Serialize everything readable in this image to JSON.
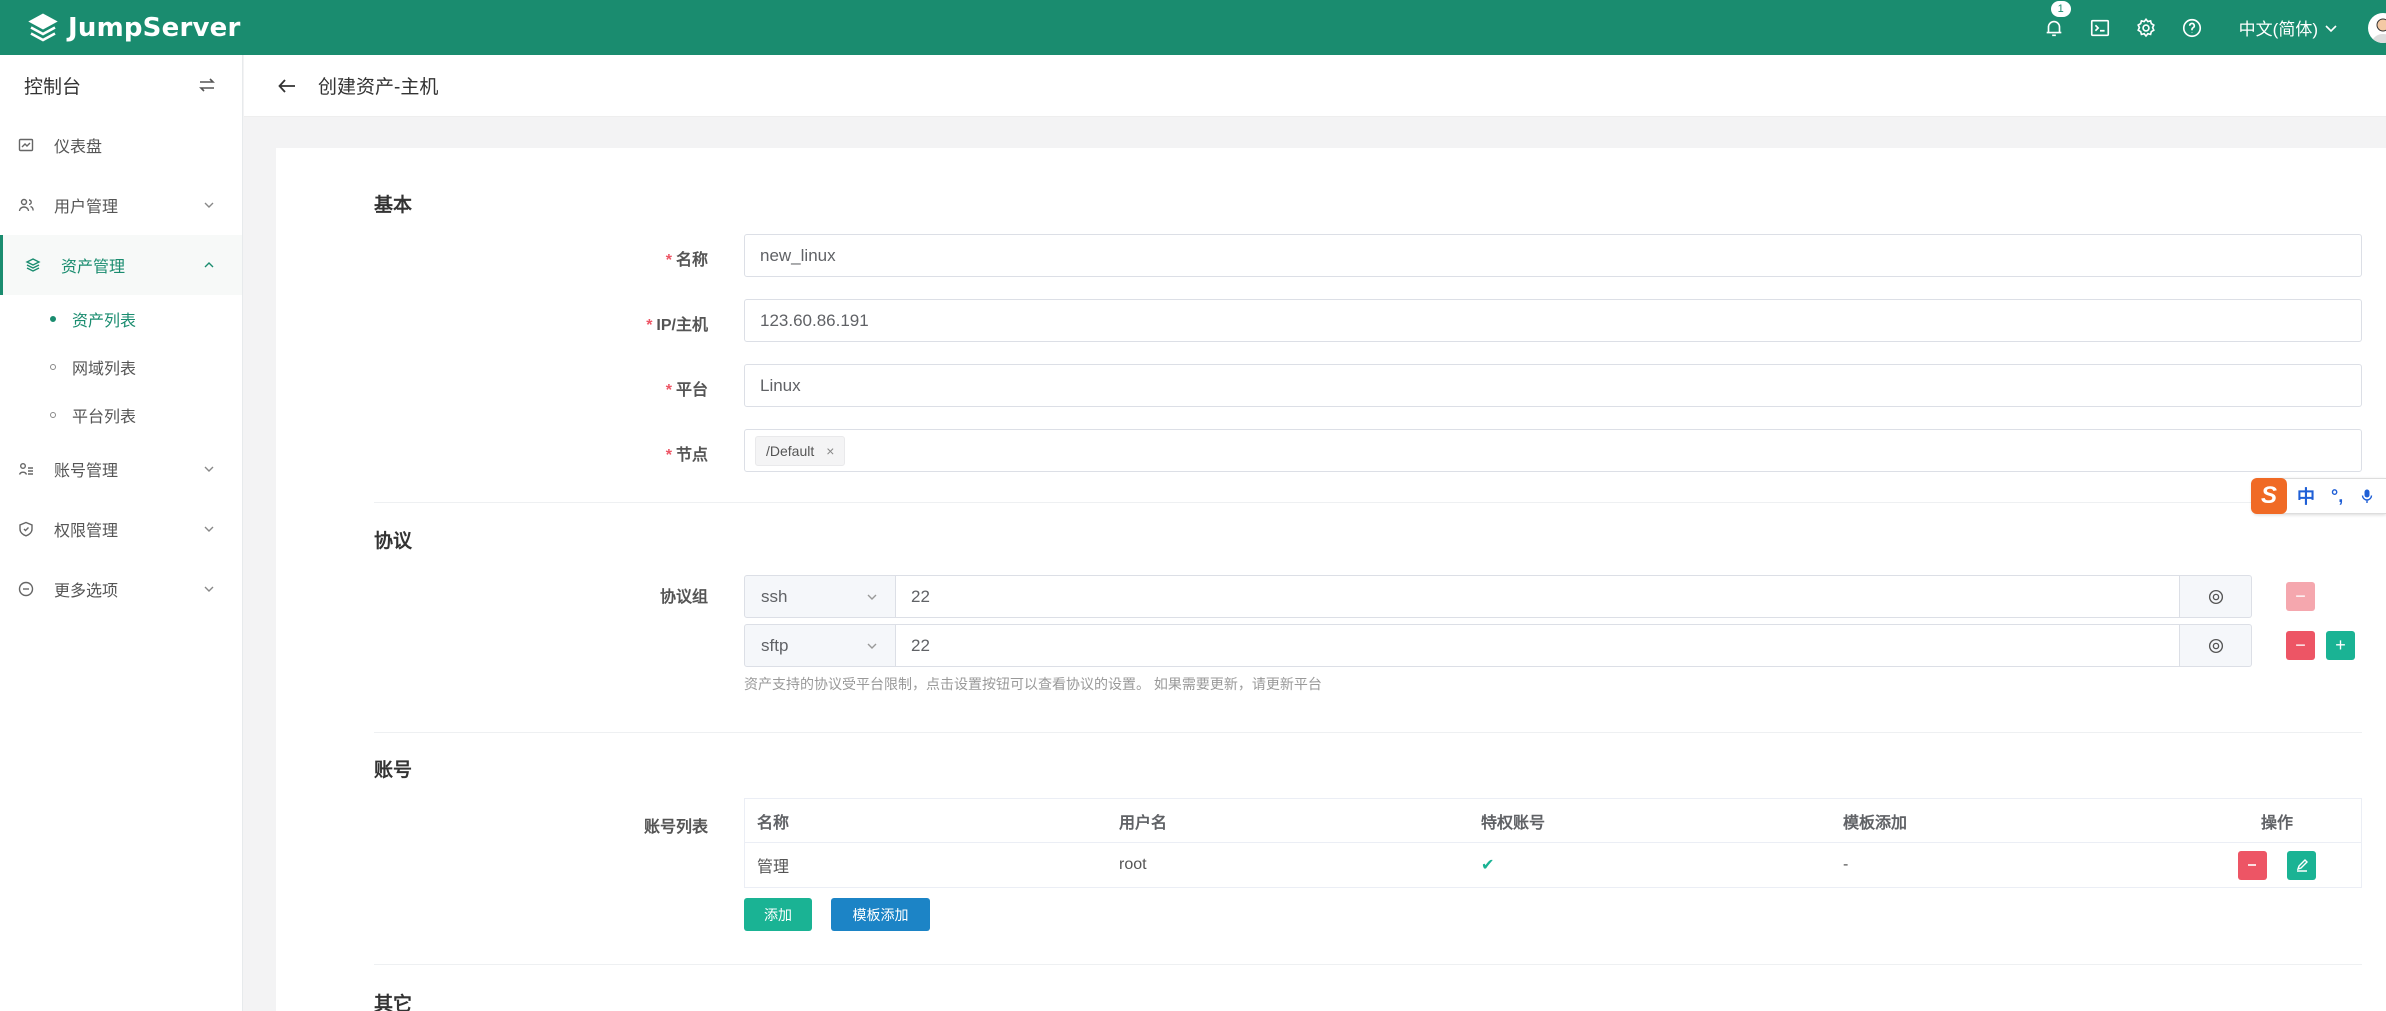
{
  "app": {
    "logo_text": "JumpServer",
    "notification_count": "1",
    "language": "中文(简体)"
  },
  "sidebar": {
    "title": "控制台",
    "items": [
      {
        "label": "仪表盘"
      },
      {
        "label": "用户管理"
      },
      {
        "label": "资产管理"
      },
      {
        "label": "账号管理"
      },
      {
        "label": "权限管理"
      },
      {
        "label": "更多选项"
      }
    ],
    "asset_sub": [
      {
        "label": "资产列表"
      },
      {
        "label": "网域列表"
      },
      {
        "label": "平台列表"
      }
    ]
  },
  "page": {
    "title": "创建资产-主机"
  },
  "basic": {
    "title": "基本",
    "name_label": "名称",
    "name_value": "new_linux",
    "ip_label": "IP/主机",
    "ip_value": "123.60.86.191",
    "platform_label": "平台",
    "platform_value": "Linux",
    "node_label": "节点",
    "node_tag": "/Default"
  },
  "protocols": {
    "title": "协议",
    "group_label": "协议组",
    "rows": [
      {
        "name": "ssh",
        "port": "22"
      },
      {
        "name": "sftp",
        "port": "22"
      }
    ],
    "hint": "资产支持的协议受平台限制，点击设置按钮可以查看协议的设置。 如果需要更新，请更新平台"
  },
  "accounts": {
    "title": "账号",
    "list_label": "账号列表",
    "headers": {
      "name": "名称",
      "username": "用户名",
      "privileged": "特权账号",
      "template": "模板添加",
      "actions": "操作"
    },
    "rows": [
      {
        "name": "管理",
        "username": "root",
        "privileged": "✔",
        "template": "-"
      }
    ],
    "add_button": "添加",
    "template_button": "模板添加"
  },
  "other": {
    "title": "其它"
  },
  "ime": {
    "mode": "中",
    "punct": "°,"
  },
  "colors": {
    "brand": "#1a8c6f",
    "danger": "#ed5565",
    "primary": "#1ab394",
    "info": "#1c84c6"
  }
}
